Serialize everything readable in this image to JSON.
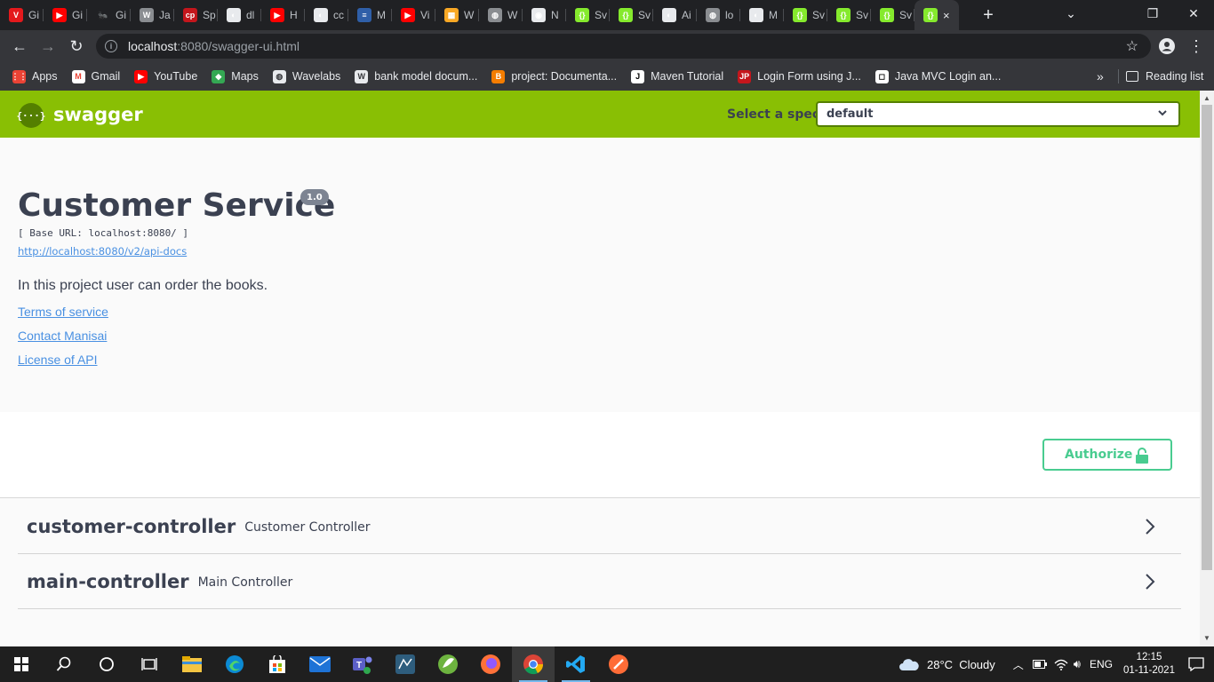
{
  "browser": {
    "tabs": [
      {
        "label": "Gi",
        "fav_color": "#e4191c",
        "fav_text": "V"
      },
      {
        "label": "Gi",
        "fav_color": "#ff0000",
        "fav_text": "▶"
      },
      {
        "label": "Gi",
        "fav_color": "#202124",
        "fav_text": "🐜"
      },
      {
        "label": "Ja",
        "fav_color": "#8a8d91",
        "fav_text": "W"
      },
      {
        "label": "Sp",
        "fav_color": "#c4161c",
        "fav_text": "cp"
      },
      {
        "label": "dl",
        "fav_color": "#e8eaed",
        "fav_text": "◐"
      },
      {
        "label": "H",
        "fav_color": "#ff0000",
        "fav_text": "▶"
      },
      {
        "label": "cc",
        "fav_color": "#e8eaed",
        "fav_text": "◐"
      },
      {
        "label": "M",
        "fav_color": "#2f5fa8",
        "fav_text": "≡"
      },
      {
        "label": "Vi",
        "fav_color": "#ff0000",
        "fav_text": "▶"
      },
      {
        "label": "W",
        "fav_color": "#f9a825",
        "fav_text": "▦"
      },
      {
        "label": "W",
        "fav_color": "#8a8d91",
        "fav_text": "◍"
      },
      {
        "label": "N",
        "fav_color": "#e8eaed",
        "fav_text": "◉"
      },
      {
        "label": "Sv",
        "fav_color": "#85ea2d",
        "fav_text": "{}"
      },
      {
        "label": "Sv",
        "fav_color": "#85ea2d",
        "fav_text": "{}"
      },
      {
        "label": "Ai",
        "fav_color": "#e8eaed",
        "fav_text": "◐"
      },
      {
        "label": "lo",
        "fav_color": "#8a8d91",
        "fav_text": "◍"
      },
      {
        "label": "M",
        "fav_color": "#e8eaed",
        "fav_text": "◐"
      },
      {
        "label": "Sv",
        "fav_color": "#85ea2d",
        "fav_text": "{}"
      },
      {
        "label": "Sv",
        "fav_color": "#85ea2d",
        "fav_text": "{}"
      },
      {
        "label": "Sv",
        "fav_color": "#85ea2d",
        "fav_text": "{}"
      }
    ],
    "active_tab": {
      "label": "×",
      "fav_color": "#85ea2d",
      "fav_text": "{}"
    },
    "new_tab": "+",
    "url_host": "localhost",
    "url_path": ":8080/swagger-ui.html",
    "bookmarks": [
      {
        "label": "Apps",
        "fav_color": "#ea4335",
        "fav_text": "⋮⋮"
      },
      {
        "label": "Gmail",
        "fav_color": "#ffffff",
        "fav_text": "M",
        "fav_fg": "#ea4335"
      },
      {
        "label": "YouTube",
        "fav_color": "#ff0000",
        "fav_text": "▶"
      },
      {
        "label": "Maps",
        "fav_color": "#34a853",
        "fav_text": "◆"
      },
      {
        "label": "Wavelabs",
        "fav_color": "#e8eaed",
        "fav_text": "◍",
        "fav_fg": "#35363a"
      },
      {
        "label": "bank model docum...",
        "fav_color": "#e8eaed",
        "fav_text": "W",
        "fav_fg": "#35363a"
      },
      {
        "label": "project: Documenta...",
        "fav_color": "#f57d00",
        "fav_text": "B"
      },
      {
        "label": "Maven Tutorial",
        "fav_color": "#ffffff",
        "fav_text": "J",
        "fav_fg": "#000"
      },
      {
        "label": "Login Form using J...",
        "fav_color": "#c4161c",
        "fav_text": "JP"
      },
      {
        "label": "Java MVC Login an...",
        "fav_color": "#ffffff",
        "fav_text": "◻",
        "fav_fg": "#000"
      }
    ],
    "more_bookmarks": "»",
    "reading_list": "Reading list"
  },
  "swagger": {
    "logo_text": "swagger",
    "select_label": "Select a spec",
    "selected_spec": "default",
    "title": "Customer Service",
    "version": "1.0",
    "base_url": "[ Base URL: localhost:8080/ ]",
    "api_docs_link": "http://localhost:8080/v2/api-docs",
    "description": "In this project user can order the books.",
    "links": [
      "Terms of service",
      "Contact Manisai",
      "License of API"
    ],
    "authorize_label": "Authorize",
    "tags": [
      {
        "name": "customer-controller",
        "description": "Customer Controller"
      },
      {
        "name": "main-controller",
        "description": "Main Controller"
      }
    ]
  },
  "taskbar": {
    "weather": "28°C  Cloudy",
    "language": "ENG",
    "time": "12:15",
    "date": "01-11-2021"
  }
}
